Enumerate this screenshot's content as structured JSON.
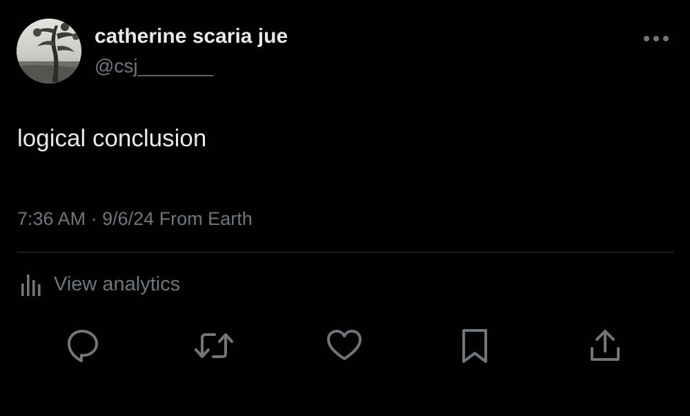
{
  "author": {
    "display_name": "catherine scaria jue",
    "handle": "@csj_______"
  },
  "tweet": {
    "text": "logical conclusion"
  },
  "meta": {
    "time": "7:36 AM",
    "separator": "·",
    "date": "9/6/24",
    "source": "From Earth"
  },
  "analytics": {
    "label": "View analytics",
    "icon": "bar-chart-icon"
  },
  "actions": [
    {
      "name": "reply",
      "icon": "speech-bubble-icon"
    },
    {
      "name": "repost",
      "icon": "repost-arrows-icon"
    },
    {
      "name": "like",
      "icon": "heart-icon"
    },
    {
      "name": "bookmark",
      "icon": "bookmark-icon"
    },
    {
      "name": "share",
      "icon": "share-upload-icon"
    }
  ],
  "colors": {
    "background": "#000000",
    "primary_text": "#e7e9ea",
    "secondary_text": "#71767b",
    "divider": "#2f3336"
  }
}
